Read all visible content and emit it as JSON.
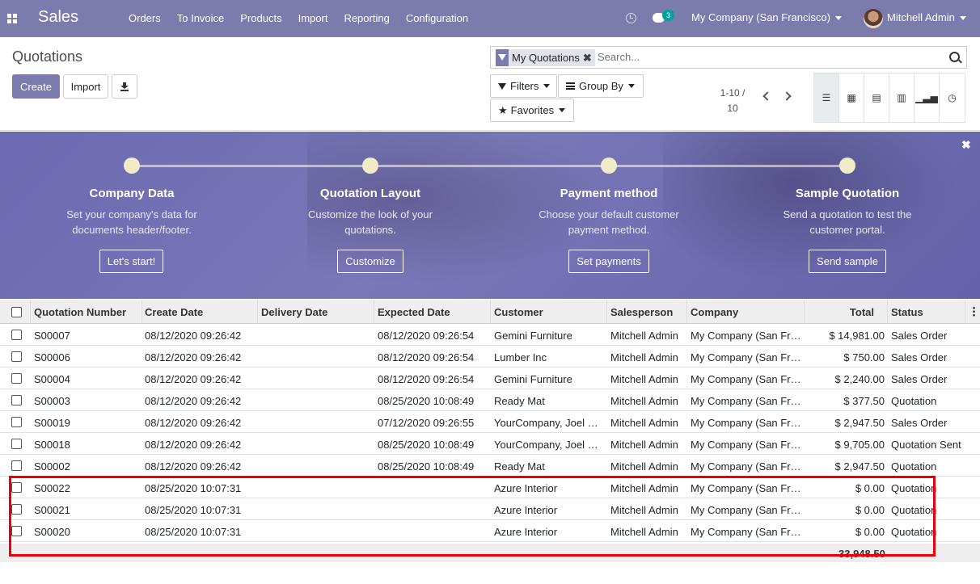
{
  "topbar": {
    "brand": "Sales",
    "menu": [
      "Orders",
      "To Invoice",
      "Products",
      "Import",
      "Reporting",
      "Configuration"
    ],
    "chat_count": "3",
    "company": "My Company (San Francisco)",
    "user": "Mitchell Admin"
  },
  "control_panel": {
    "title": "Quotations",
    "create_label": "Create",
    "import_label": "Import",
    "search": {
      "facet": "My Quotations",
      "placeholder": "Search..."
    },
    "filters_label": "Filters",
    "groupby_label": "Group By",
    "favorites_label": "Favorites",
    "pager_range": "1-10 /",
    "pager_total": "10"
  },
  "banner": {
    "steps": [
      {
        "title": "Company Data",
        "desc1": "Set your company's data for",
        "desc2": "documents header/footer.",
        "button": "Let's start!"
      },
      {
        "title": "Quotation Layout",
        "desc1": "Customize the look of your",
        "desc2": "quotations.",
        "button": "Customize"
      },
      {
        "title": "Payment method",
        "desc1": "Choose your default customer",
        "desc2": "payment method.",
        "button": "Set payments"
      },
      {
        "title": "Sample Quotation",
        "desc1": "Send a quotation to test the",
        "desc2": "customer portal.",
        "button": "Send sample"
      }
    ]
  },
  "table": {
    "columns": [
      "Quotation Number",
      "Create Date",
      "Delivery Date",
      "Expected Date",
      "Customer",
      "Salesperson",
      "Company",
      "Total",
      "Status"
    ],
    "rows": [
      [
        "S00007",
        "08/12/2020 09:26:42",
        "",
        "08/12/2020 09:26:54",
        "Gemini Furniture",
        "Mitchell Admin",
        "My Company (San Fr…",
        "$ 14,981.00",
        "Sales Order"
      ],
      [
        "S00006",
        "08/12/2020 09:26:42",
        "",
        "08/12/2020 09:26:54",
        "Lumber Inc",
        "Mitchell Admin",
        "My Company (San Fr…",
        "$ 750.00",
        "Sales Order"
      ],
      [
        "S00004",
        "08/12/2020 09:26:42",
        "",
        "08/12/2020 09:26:54",
        "Gemini Furniture",
        "Mitchell Admin",
        "My Company (San Fr…",
        "$ 2,240.00",
        "Sales Order"
      ],
      [
        "S00003",
        "08/12/2020 09:26:42",
        "",
        "08/25/2020 10:08:49",
        "Ready Mat",
        "Mitchell Admin",
        "My Company (San Fr…",
        "$ 377.50",
        "Quotation"
      ],
      [
        "S00019",
        "08/12/2020 09:26:42",
        "",
        "07/12/2020 09:26:55",
        "YourCompany, Joel …",
        "Mitchell Admin",
        "My Company (San Fr…",
        "$ 2,947.50",
        "Sales Order"
      ],
      [
        "S00018",
        "08/12/2020 09:26:42",
        "",
        "08/25/2020 10:08:49",
        "YourCompany, Joel …",
        "Mitchell Admin",
        "My Company (San Fr…",
        "$ 9,705.00",
        "Quotation Sent"
      ],
      [
        "S00002",
        "08/12/2020 09:26:42",
        "",
        "08/25/2020 10:08:49",
        "Ready Mat",
        "Mitchell Admin",
        "My Company (San Fr…",
        "$ 2,947.50",
        "Quotation"
      ],
      [
        "S00022",
        "08/25/2020 10:07:31",
        "",
        "",
        "Azure Interior",
        "Mitchell Admin",
        "My Company (San Fr…",
        "$ 0.00",
        "Quotation"
      ],
      [
        "S00021",
        "08/25/2020 10:07:31",
        "",
        "",
        "Azure Interior",
        "Mitchell Admin",
        "My Company (San Fr…",
        "$ 0.00",
        "Quotation"
      ],
      [
        "S00020",
        "08/25/2020 10:07:31",
        "",
        "",
        "Azure Interior",
        "Mitchell Admin",
        "My Company (San Fr…",
        "$ 0.00",
        "Quotation"
      ]
    ],
    "grand_total": "33,948.50"
  },
  "colors": {
    "brand": "#7c7bad",
    "highlight": "#e8000b"
  }
}
